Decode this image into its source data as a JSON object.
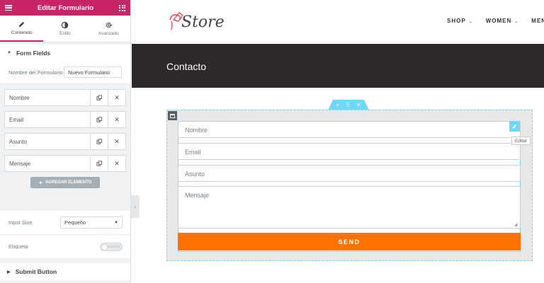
{
  "panel": {
    "title": "Editar Formulario",
    "tabs": [
      {
        "label": "Contenido",
        "icon": "pencil-icon"
      },
      {
        "label": "Estilo",
        "icon": "contrast-icon"
      },
      {
        "label": "Avanzado",
        "icon": "gear-icon"
      }
    ],
    "form_fields_section": "Form Fields",
    "form_name_label": "Nombre del Formulario",
    "form_name_value": "Nuevo Formulario",
    "fields": [
      "Nombre",
      "Email",
      "Asunto",
      "Mensaje"
    ],
    "add_button": "AGREGAR ELEMENTO",
    "input_size_label": "Input Size",
    "input_size_value": "Pequeño",
    "label_label": "Etiqueta",
    "label_switch": "OCULTO",
    "submit_section": "Submit Button"
  },
  "site": {
    "logo_text": "Store",
    "nav": [
      "SHOP",
      "WOMEN",
      "MEN"
    ],
    "hero_title": "Contacto",
    "form": {
      "placeholders": [
        "Nombre",
        "Email",
        "Asunto",
        "Mensaje"
      ],
      "send_label": "SEND",
      "edit_tooltip": "Editar"
    }
  },
  "colors": {
    "brand": "#c8246a",
    "hero_bg": "#2e2929",
    "handle": "#71d7f7",
    "send": "#ff7200"
  }
}
